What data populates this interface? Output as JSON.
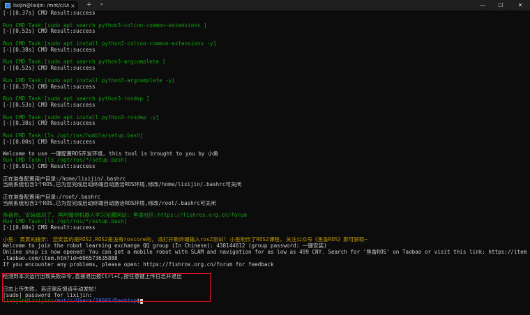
{
  "titlebar": {
    "tab_title": "lixijin@lixijin: /mnt/c/Users/19",
    "close": "×",
    "new_tab": "+",
    "dropdown": "⌄",
    "minimize": "—",
    "maximize": "☐",
    "close_window": "✕"
  },
  "lines": [
    {
      "t": "[-][0.37s] CMD Result:success",
      "c": "w"
    },
    {
      "t": "",
      "c": "w"
    },
    {
      "t": "Run CMD Task:[sudo apt search python3-colcon-common-extensions ]",
      "c": "g"
    },
    {
      "t": "[-][0.52s] CMD Result:success",
      "c": "w"
    },
    {
      "t": "",
      "c": "w"
    },
    {
      "t": "Run CMD Task:[sudo apt install python3-colcon-common-extensions -y]",
      "c": "g"
    },
    {
      "t": "[-][0.38s] CMD Result:success",
      "c": "w"
    },
    {
      "t": "",
      "c": "w"
    },
    {
      "t": "Run CMD Task:[sudo apt search python3-argcomplete ]",
      "c": "g"
    },
    {
      "t": "[-][0.52s] CMD Result:success",
      "c": "w"
    },
    {
      "t": "",
      "c": "w"
    },
    {
      "t": "Run CMD Task:[sudo apt install python3-argcomplete -y]",
      "c": "g"
    },
    {
      "t": "[-][0.37s] CMD Result:success",
      "c": "w"
    },
    {
      "t": "",
      "c": "w"
    },
    {
      "t": "Run CMD Task:[sudo apt search python3-rosdep ]",
      "c": "g"
    },
    {
      "t": "[-][0.53s] CMD Result:success",
      "c": "w"
    },
    {
      "t": "",
      "c": "w"
    },
    {
      "t": "Run CMD Task:[sudo apt install python3-rosdep -y]",
      "c": "g"
    },
    {
      "t": "[-][0.38s] CMD Result:success",
      "c": "w"
    },
    {
      "t": "",
      "c": "w"
    },
    {
      "t": "Run CMD Task:[ls /opt/ros/humble/setup.bash]",
      "c": "g"
    },
    {
      "t": "[-][0.00s] CMD Result:success",
      "c": "w"
    },
    {
      "t": "",
      "c": "w"
    },
    {
      "t": "Welcome to use 一键配置ROS开发环境, this tool is brought to you by 小鱼",
      "c": "w"
    },
    {
      "t": "Run CMD Task:[ls /opt/ros/*/setup.bash]",
      "c": "g"
    },
    {
      "t": "[-][0.01s] CMD Result:success",
      "c": "w"
    },
    {
      "t": "",
      "c": "w"
    },
    {
      "t": "正在准备配置用户目录:/home/lixijin/.bashrc",
      "c": "w"
    },
    {
      "t": "当前系统包含1个ROS,已为您完成启动终端自动激活ROS环境,修改/home/lixijin/.bashrc可关闭",
      "c": "w"
    },
    {
      "t": "",
      "c": "w"
    },
    {
      "t": "正在准备配置用户目录:/root/.bashrc",
      "c": "w"
    },
    {
      "t": "当前系统包含1个ROS,已为您完成启动终端自动激活ROS环境,修改/root/.bashrc可关闭",
      "c": "w"
    },
    {
      "t": "",
      "c": "w"
    },
    {
      "t": "恭喜你, 安装成功了, 再附赠你机器人学习宝藏网站: 鱼香社区:https://fishros.org.cn/forum",
      "c": "g"
    },
    {
      "t": "Run CMD Task:[ls /opt/ros/*/setup.bash]",
      "c": "g"
    },
    {
      "t": "[-][0.00s] CMD Result:success",
      "c": "w"
    },
    {
      "t": "",
      "c": "w"
    },
    {
      "t": "小鱼: 黄黄的提示: 您安装的是ROS2,ROS2是没有roscore的, 请打开新终端输入ros2测试! 小鱼制作了ROS2课程, 关注公众号《鱼香ROS》即可获取~",
      "c": "y"
    },
    {
      "t": "Welcome to join the robot learning exchange QQ group (In Chinese): 438144612 (group password: 一键安装)",
      "c": "w"
    },
    {
      "t": "Online shop is now opened! You can get a mobile robot with SLAM and navigation for as low as 499 CNY. Search for '鱼香ROS' on Taobao or visit this link: https://item",
      "c": "w"
    },
    {
      "t": ".taobao.com/item.htm?id=696573635888",
      "c": "w"
    },
    {
      "t": "If you encounter any problems, please open: https://fishros.org.cn/forum for feedback",
      "c": "w"
    },
    {
      "t": "",
      "c": "w"
    },
    {
      "t": "检测到本次运行出现失败命令,直接退出按Ctrl+C,按任意键上传日志并退出",
      "c": "w"
    },
    {
      "t": "",
      "c": "w"
    },
    {
      "t": "日志上传失败, 若还需反馈请手动发帖!",
      "c": "w"
    },
    {
      "t": "[sudo] password for lixijin:",
      "c": "w"
    }
  ],
  "prompt": {
    "user_host": "lixijin@lixijin",
    "sep": ":",
    "path": "/mnt/c/Users/19605/Desktop",
    "symbol": "$"
  }
}
